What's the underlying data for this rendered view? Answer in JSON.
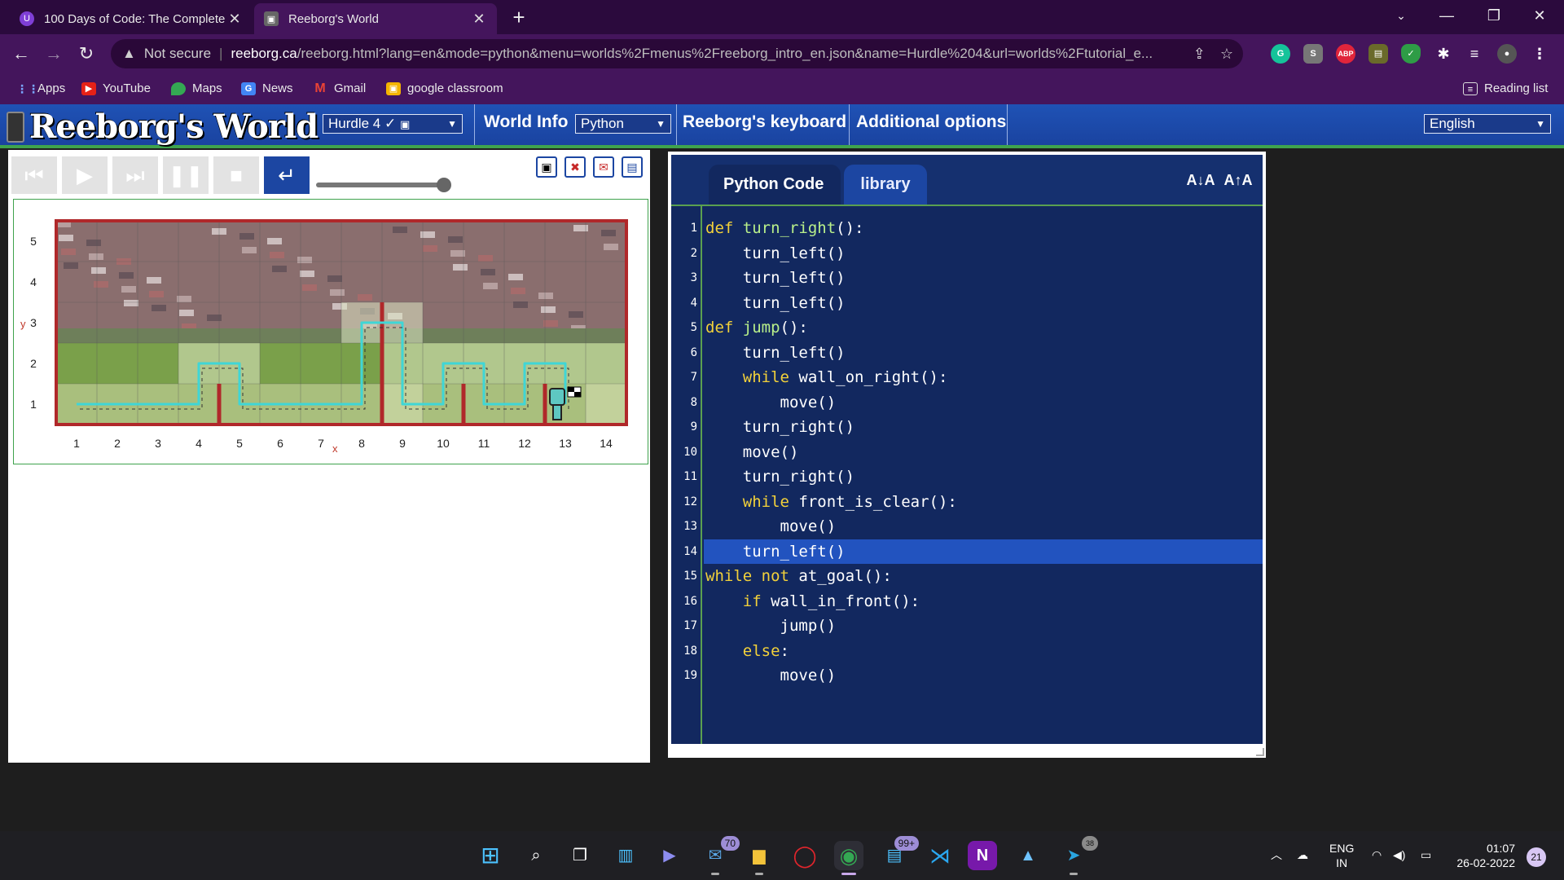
{
  "browser": {
    "tabs": [
      {
        "title": "100 Days of Code: The Complete",
        "favicon": "udemy-icon",
        "active": false
      },
      {
        "title": "Reeborg's World",
        "favicon": "reeborg-icon",
        "active": true
      }
    ],
    "address": {
      "security": "Not secure",
      "host": "reeborg.ca",
      "path": "/reeborg.html?lang=en&mode=python&menu=worlds%2Fmenus%2Freeborg_intro_en.json&name=Hurdle%204&url=worlds%2Ftutorial_e..."
    },
    "bookmarks": [
      "Apps",
      "YouTube",
      "Maps",
      "News",
      "Gmail",
      "google classroom"
    ],
    "reading_list": "Reading list"
  },
  "header": {
    "logo": "Reeborg's World",
    "world_select": "Hurdle 4 ✓",
    "world_info": "World Info",
    "language_select": "Python",
    "keyboard": "Reeborg's keyboard",
    "additional": "Additional options",
    "ui_language": "English"
  },
  "world": {
    "x_ticks": [
      "1",
      "2",
      "3",
      "4",
      "5",
      "6",
      "7",
      "8",
      "9",
      "10",
      "11",
      "12",
      "13",
      "14"
    ],
    "y_ticks": [
      "1",
      "2",
      "3",
      "4",
      "5"
    ],
    "x_label": "x",
    "y_label": "y"
  },
  "code": {
    "tab_active": "Python Code",
    "tab_other": "library",
    "font_down": "A↓A",
    "font_up": "A↑A",
    "highlighted_line": 14,
    "lines": [
      {
        "n": "1",
        "indent": "",
        "tokens": [
          [
            "kw",
            "def "
          ],
          [
            "fn",
            "turn_right"
          ],
          [
            "",
            "():"
          ]
        ]
      },
      {
        "n": "2",
        "indent": "    ",
        "tokens": [
          [
            "",
            "turn_left()"
          ]
        ]
      },
      {
        "n": "3",
        "indent": "    ",
        "tokens": [
          [
            "",
            "turn_left()"
          ]
        ]
      },
      {
        "n": "4",
        "indent": "    ",
        "tokens": [
          [
            "",
            "turn_left()"
          ]
        ]
      },
      {
        "n": "5",
        "indent": "",
        "tokens": [
          [
            "kw",
            "def "
          ],
          [
            "fn",
            "jump"
          ],
          [
            "",
            "():"
          ]
        ]
      },
      {
        "n": "6",
        "indent": "    ",
        "tokens": [
          [
            "",
            "turn_left()"
          ]
        ]
      },
      {
        "n": "7",
        "indent": "    ",
        "tokens": [
          [
            "kw",
            "while "
          ],
          [
            "",
            "wall_on_right():"
          ]
        ]
      },
      {
        "n": "8",
        "indent": "        ",
        "tokens": [
          [
            "",
            "move()"
          ]
        ]
      },
      {
        "n": "9",
        "indent": "    ",
        "tokens": [
          [
            "",
            "turn_right()"
          ]
        ]
      },
      {
        "n": "10",
        "indent": "    ",
        "tokens": [
          [
            "",
            "move()"
          ]
        ]
      },
      {
        "n": "11",
        "indent": "    ",
        "tokens": [
          [
            "",
            "turn_right()"
          ]
        ]
      },
      {
        "n": "12",
        "indent": "    ",
        "tokens": [
          [
            "kw",
            "while "
          ],
          [
            "",
            "front_is_clear():"
          ]
        ]
      },
      {
        "n": "13",
        "indent": "        ",
        "tokens": [
          [
            "",
            "move()"
          ]
        ]
      },
      {
        "n": "14",
        "indent": "    ",
        "tokens": [
          [
            "",
            "turn_left()"
          ]
        ]
      },
      {
        "n": "15",
        "indent": "",
        "tokens": [
          [
            "kw",
            "while not "
          ],
          [
            "",
            "at_goal():"
          ]
        ]
      },
      {
        "n": "16",
        "indent": "    ",
        "tokens": [
          [
            "kw",
            "if "
          ],
          [
            "",
            "wall_in_front():"
          ]
        ]
      },
      {
        "n": "17",
        "indent": "        ",
        "tokens": [
          [
            "",
            "jump()"
          ]
        ]
      },
      {
        "n": "18",
        "indent": "    ",
        "tokens": [
          [
            "kw",
            "else"
          ],
          [
            "",
            ":"
          ]
        ]
      },
      {
        "n": "19",
        "indent": "        ",
        "tokens": [
          [
            "",
            "move()"
          ]
        ]
      }
    ]
  },
  "taskbar": {
    "badges": {
      "mail": "70",
      "store": "99+",
      "telegram": "38"
    },
    "lang_top": "ENG",
    "lang_bottom": "IN",
    "time": "01:07",
    "date": "26-02-2022",
    "notifications": "21"
  },
  "colors": {
    "header_blue": "#1f52b5",
    "accent_green": "#3fa34d",
    "code_bg": "#12285f",
    "keyword": "#f2d13a",
    "function_name": "#b9f08a",
    "highlight": "#2253bf",
    "wall": "#b0282a",
    "trace": "#3fd6d6"
  }
}
